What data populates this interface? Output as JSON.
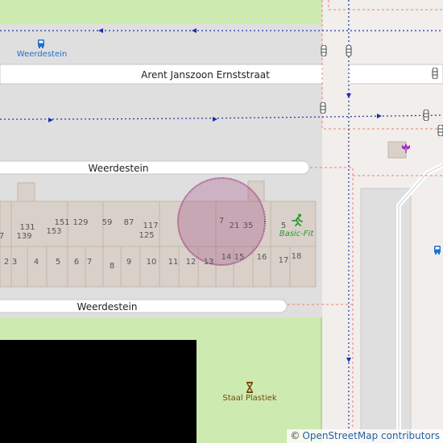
{
  "map": {
    "streets": {
      "arent": "Arent Janszoon Ernststraat",
      "weerdestein_north": "Weerdestein",
      "weerdestein_south": "Weerdestein"
    },
    "stops": {
      "weerdestein_stop": "Weerdestein"
    },
    "pois": {
      "basic_fit": "Basic-Fit",
      "staal_plastiek": "Staal Plastiek"
    },
    "house_numbers": {
      "n131": "131",
      "n139": "139",
      "n151": "151",
      "n153": "153",
      "n129": "129",
      "n59": "59",
      "n87": "87",
      "n117": "117",
      "n125": "125",
      "n7a": "7",
      "n21": "21",
      "n35": "35",
      "n5": "5",
      "n7b": "7",
      "n2": "2",
      "n3": "3",
      "n4": "4",
      "n5b": "5",
      "n6": "6",
      "n7c": "7",
      "n8": "8",
      "n9": "9",
      "n10": "10",
      "n11": "11",
      "n12": "12",
      "n13": "13",
      "n14": "14",
      "n15": "15",
      "n16": "16",
      "n17": "17",
      "n18": "18"
    },
    "colors": {
      "road_fill": "#ffffff",
      "area_grey": "#e0dfdf",
      "park_green": "#cdebb0",
      "building": "#d9d0c9",
      "building_outline": "#c4b6ab",
      "transit_line": "#0000cc",
      "boundary_pink": "#f08070",
      "circle_marker": "#9b3c7a",
      "basic_fit_green": "#2a9a2a"
    },
    "icons": {
      "bus_stop": "bus-stop-icon",
      "tram_stop": "tram-stop-icon",
      "fitness": "fitness-icon",
      "artwork": "artwork-icon",
      "garden_centre": "flower-icon"
    }
  },
  "attribution": {
    "symbol": "©",
    "text": "OpenStreetMap contributors"
  }
}
